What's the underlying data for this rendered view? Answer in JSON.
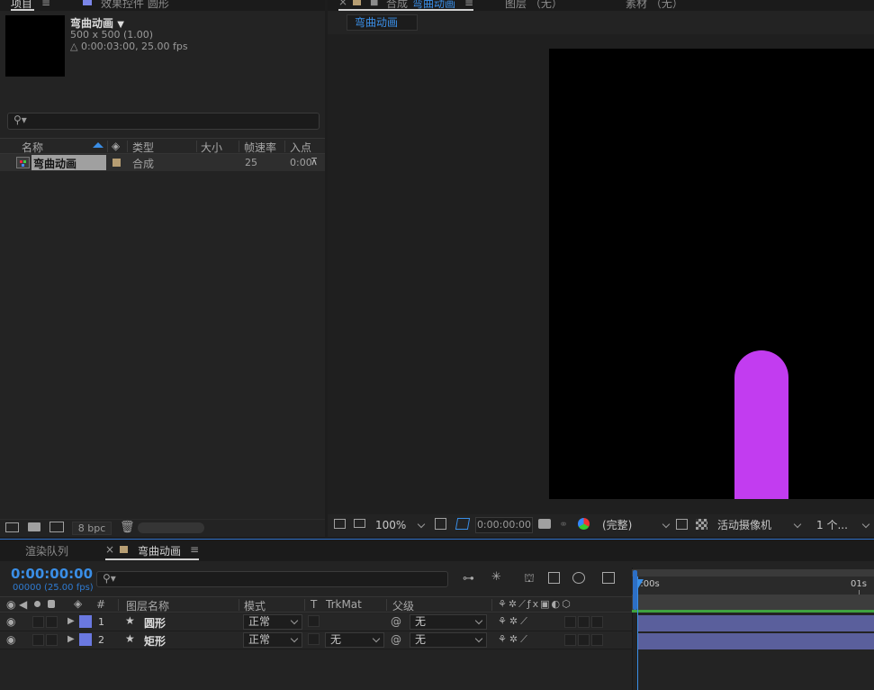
{
  "project_panel": {
    "tab_project": "项目",
    "tab_effects": "效果控件 圆形",
    "comp": {
      "name": "弯曲动画",
      "size": "500 x 500 (1.00)",
      "duration": "△ 0:00:03:00, 25.00 fps"
    },
    "columns": {
      "name": "名称",
      "type": "类型",
      "size": "大小",
      "fps": "帧速率",
      "in_point": "入点"
    },
    "items": [
      {
        "name": "弯曲动画",
        "type": "合成",
        "size": "",
        "fps": "25",
        "in_point": "0:00"
      }
    ],
    "bpc": "8 bpc"
  },
  "viewer": {
    "tab_comp_prefix": "合成",
    "tab_comp_name": "弯曲动画",
    "tab_layer": "图层 （无）",
    "tab_footage": "素材 （无）",
    "breadcrumb": "弯曲动画",
    "zoom": "100%",
    "timecode": "0:00:00:00",
    "resolution": "(完整)",
    "camera": "活动摄像机",
    "views": "1 个..."
  },
  "timeline": {
    "tab_render_queue": "渲染队列",
    "tab_comp": "弯曲动画",
    "current_time": "0:00:00:00",
    "frames": "00000 (25.00 fps)",
    "ruler_start": "0:00s",
    "ruler_1s": "01s",
    "columns": {
      "num": "#",
      "layer_name": "图层名称",
      "mode": "模式",
      "t": "T",
      "trkmat": "TrkMat",
      "parent": "父级"
    },
    "layers": [
      {
        "num": "1",
        "name": "圆形",
        "mode": "正常",
        "trkmat": "",
        "parent": "无",
        "color": "#6a78e0"
      },
      {
        "num": "2",
        "name": "矩形",
        "mode": "正常",
        "trkmat": "无",
        "parent": "无",
        "color": "#6a78e0"
      }
    ]
  },
  "colors": {
    "accent_blue": "#3a8ee6",
    "shape_purple": "#c23cf0",
    "label_tan": "#b79e73",
    "layer_label": "#6a78e0"
  }
}
